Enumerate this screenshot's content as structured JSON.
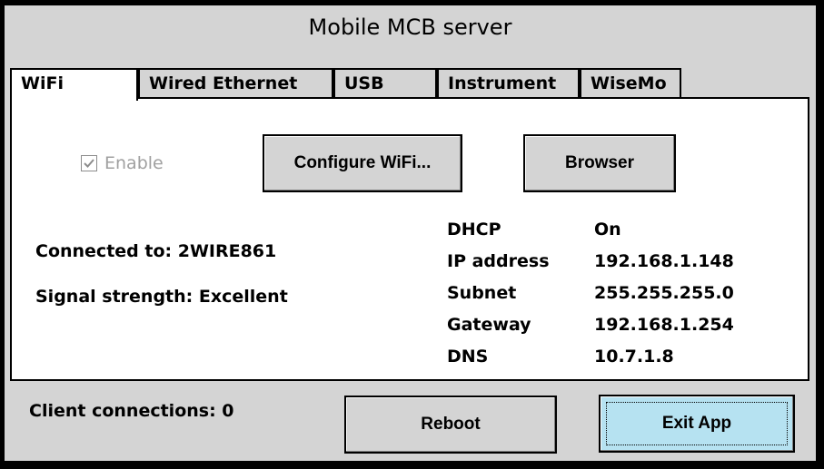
{
  "window": {
    "title": "Mobile MCB server"
  },
  "tabs": [
    {
      "label": "WiFi",
      "active": true
    },
    {
      "label": "Wired Ethernet",
      "active": false
    },
    {
      "label": "USB",
      "active": false
    },
    {
      "label": "Instrument",
      "active": false
    },
    {
      "label": "WiseMo",
      "active": false
    }
  ],
  "wifi": {
    "enable_label": "Enable",
    "enable_checked": true,
    "configure_button": "Configure WiFi...",
    "browser_button": "Browser",
    "connected_to": "Connected to: 2WIRE861",
    "signal_strength": "Signal strength: Excellent",
    "network_info": [
      {
        "label": "DHCP",
        "value": "On"
      },
      {
        "label": "IP address",
        "value": "192.168.1.148"
      },
      {
        "label": "Subnet",
        "value": "255.255.255.0"
      },
      {
        "label": "Gateway",
        "value": "192.168.1.254"
      },
      {
        "label": "DNS",
        "value": "10.7.1.8"
      }
    ]
  },
  "footer": {
    "client_connections": "Client connections: 0",
    "reboot_button": "Reboot",
    "exit_button": "Exit App"
  }
}
